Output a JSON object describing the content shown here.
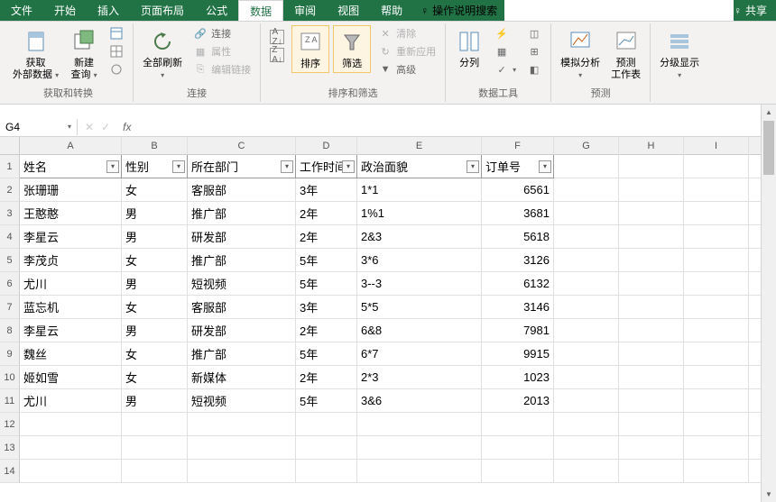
{
  "tabs": {
    "file": "文件",
    "home": "开始",
    "insert": "插入",
    "layout": "页面布局",
    "formulas": "公式",
    "data": "数据",
    "review": "审阅",
    "view": "视图",
    "help": "帮助",
    "tellme": "操作说明搜索",
    "share": "共享"
  },
  "ribbon": {
    "group1": {
      "label": "获取和转换",
      "get_external": "获取\n外部数据",
      "new_query": "新建\n查询",
      "show_queries": "",
      "show_queries2": ""
    },
    "group2": {
      "label": "连接",
      "refresh_all": "全部刷新",
      "connections": "连接",
      "properties": "属性",
      "edit_links": "编辑链接"
    },
    "group3": {
      "label": "排序和筛选",
      "sort": "排序",
      "filter": "筛选",
      "clear": "清除",
      "reapply": "重新应用",
      "advanced": "高级"
    },
    "group4": {
      "label": "数据工具",
      "text_to_col": "分列"
    },
    "group5": {
      "label": "预测",
      "whatif": "模拟分析",
      "forecast": "预测\n工作表"
    },
    "group6": {
      "label": "",
      "outline": "分级显示"
    }
  },
  "namebox": "G4",
  "columns": [
    "A",
    "B",
    "C",
    "D",
    "E",
    "F",
    "G",
    "H",
    "I"
  ],
  "headers": {
    "c1": "姓名",
    "c2": "性别",
    "c3": "所在部门",
    "c4": "工作时间",
    "c5": "政治面貌",
    "c6": "订单号"
  },
  "rows": [
    {
      "c1": "张珊珊",
      "c2": "女",
      "c3": "客服部",
      "c4": "3年",
      "c5": "1*1",
      "c6": "6561"
    },
    {
      "c1": "王憨憨",
      "c2": "男",
      "c3": "推广部",
      "c4": "2年",
      "c5": "1%1",
      "c6": "3681"
    },
    {
      "c1": "李星云",
      "c2": "男",
      "c3": "研发部",
      "c4": "2年",
      "c5": "2&3",
      "c6": "5618"
    },
    {
      "c1": "李茂贞",
      "c2": "女",
      "c3": "推广部",
      "c4": "5年",
      "c5": "3*6",
      "c6": "3126"
    },
    {
      "c1": "尤川",
      "c2": "男",
      "c3": "短视频",
      "c4": "5年",
      "c5": "3--3",
      "c6": "6132"
    },
    {
      "c1": "蓝忘机",
      "c2": "女",
      "c3": "客服部",
      "c4": "3年",
      "c5": "5*5",
      "c6": "3146"
    },
    {
      "c1": "李星云",
      "c2": "男",
      "c3": "研发部",
      "c4": "2年",
      "c5": "6&8",
      "c6": "7981"
    },
    {
      "c1": "魏丝",
      "c2": "女",
      "c3": "推广部",
      "c4": "5年",
      "c5": "6*7",
      "c6": "9915"
    },
    {
      "c1": "姬如雪",
      "c2": "女",
      "c3": "新媒体",
      "c4": "2年",
      "c5": "2*3",
      "c6": "1023"
    },
    {
      "c1": "尤川",
      "c2": "男",
      "c3": "短视频",
      "c4": "5年",
      "c5": "3&6",
      "c6": "2013"
    }
  ]
}
